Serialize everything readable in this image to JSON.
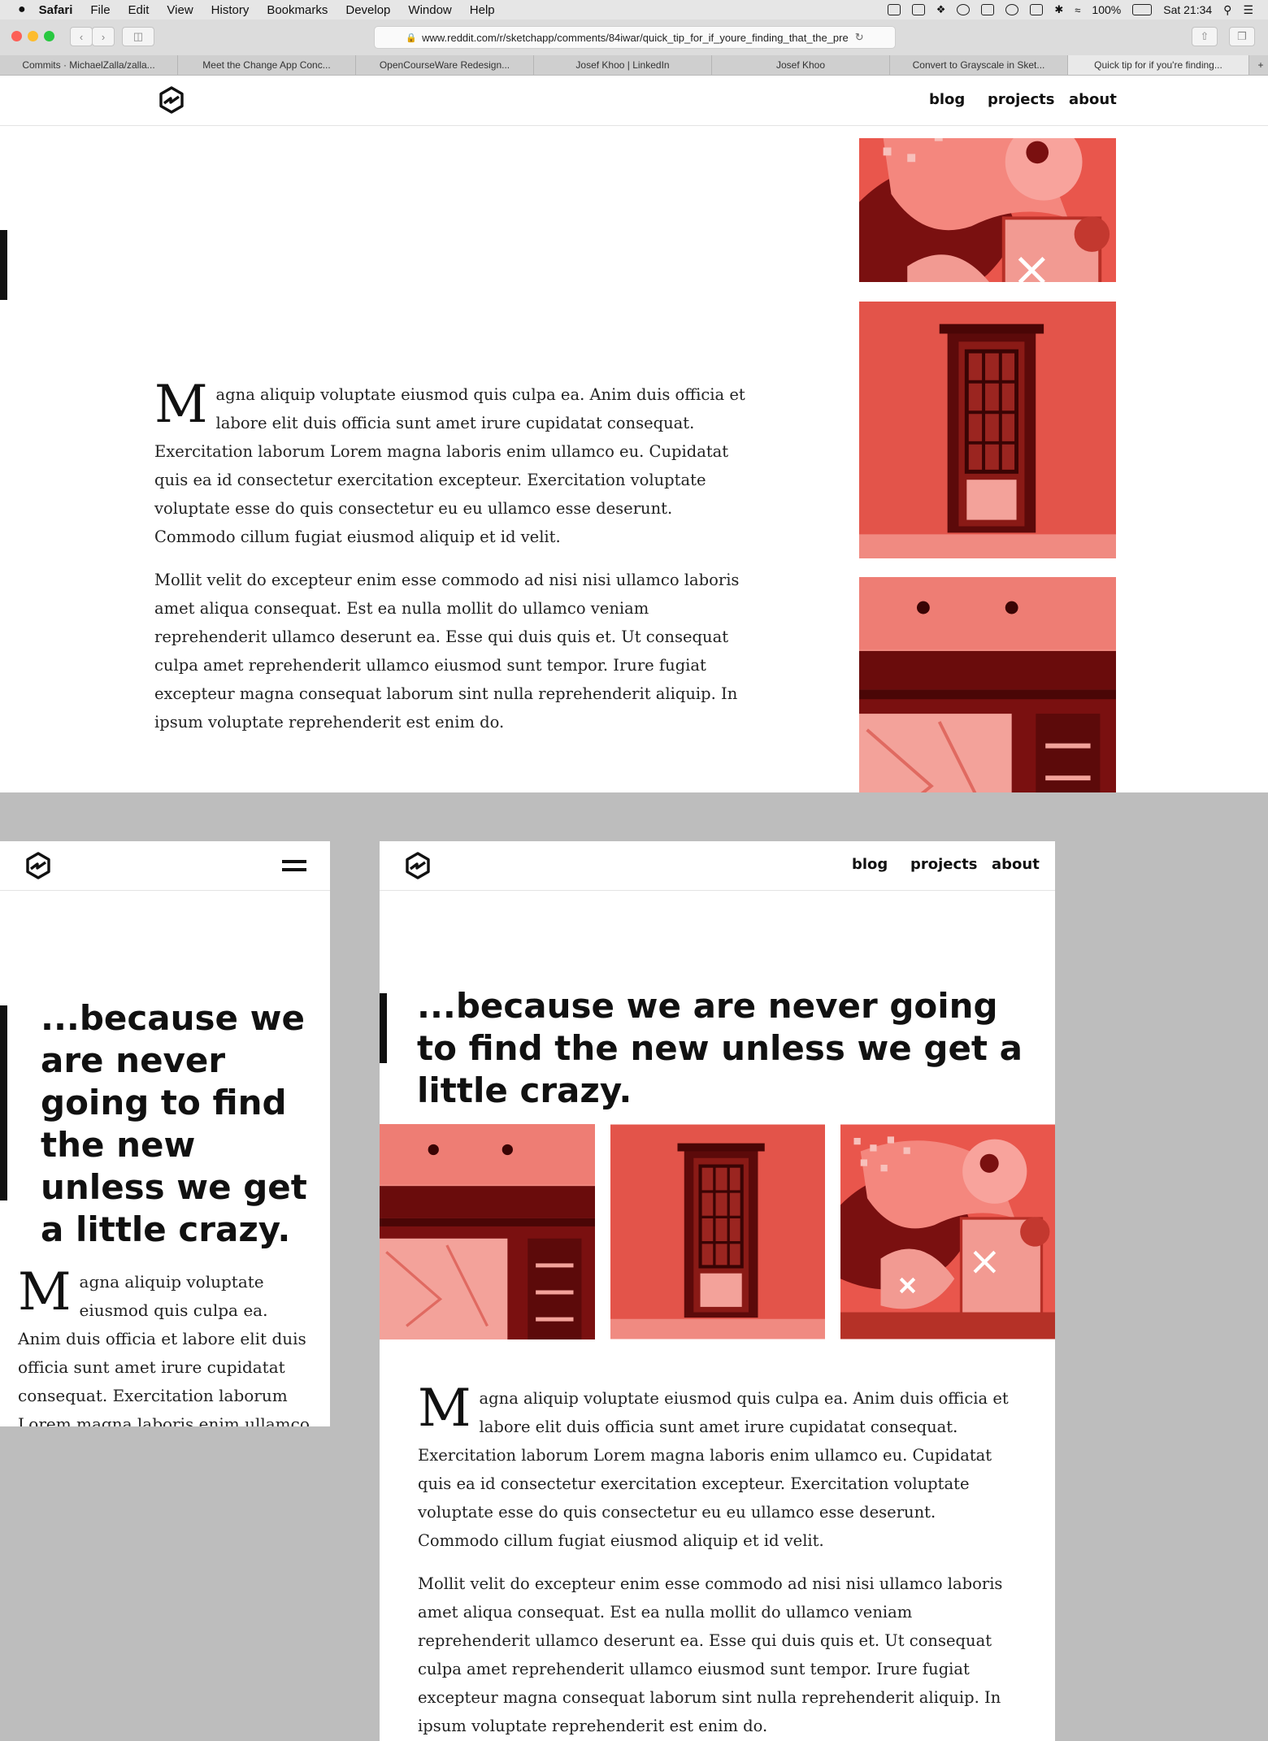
{
  "menubar": {
    "apple": "",
    "items": [
      "Safari",
      "File",
      "Edit",
      "View",
      "History",
      "Bookmarks",
      "Develop",
      "Window",
      "Help"
    ],
    "battery": "100%",
    "clock": "Sat 21:34"
  },
  "browser": {
    "url": "www.reddit.com/r/sketchapp/comments/84iwar/quick_tip_for_if_youre_finding_that_the_pre",
    "tabs": [
      "Commits · MichaelZalla/zalla...",
      "Meet the Change App Conc...",
      "OpenCourseWare Redesign...",
      "Josef Khoo | LinkedIn",
      "Josef Khoo",
      "Convert to Grayscale in Sket...",
      "Quick tip for if you're finding..."
    ],
    "active_tab": 6
  },
  "site": {
    "nav": [
      "blog",
      "projects",
      "about"
    ],
    "quote": "...because we are never going to find the new unless we get a little crazy.",
    "dropcap": "M",
    "para1": "agna aliquip voluptate eiusmod quis culpa ea. Anim duis officia et labore elit duis officia sunt amet irure cupidatat consequat. Exercitation laborum Lorem magna laboris enim ullamco eu. Cupidatat quis ea id consectetur exercitation excepteur. Exercitation voluptate voluptate esse do quis consectetur eu eu ullamco esse deserunt. Commodo cillum fugiat eiusmod aliquip et id velit.",
    "para2": "Mollit velit do excepteur enim esse commodo ad nisi nisi ullamco laboris amet aliqua consequat. Est ea nulla mollit do ullamco veniam reprehenderit ullamco deserunt ea. Esse qui duis quis et. Ut consequat culpa amet reprehenderit ullamco eiusmod sunt tempor. Irure fugiat excepteur magna consequat laborum sint nulla reprehenderit aliquip. In ipsum voluptate reprehenderit est enim do.",
    "mobile_para": "agna aliquip voluptate eiusmod quis culpa ea. Anim duis officia et labore elit duis officia sunt amet irure cupidatat consequat. Exercitation laborum Lorem magna laboris enim ullamco eu. Cupidatat"
  },
  "colors": {
    "photo_light": "#f4877e",
    "photo_mid": "#e9564c",
    "photo_dark": "#7a1010",
    "accent_bar": "#111111"
  },
  "icons": {
    "logo": "hexagon-logo-icon",
    "menu": "hamburger-menu-icon"
  }
}
